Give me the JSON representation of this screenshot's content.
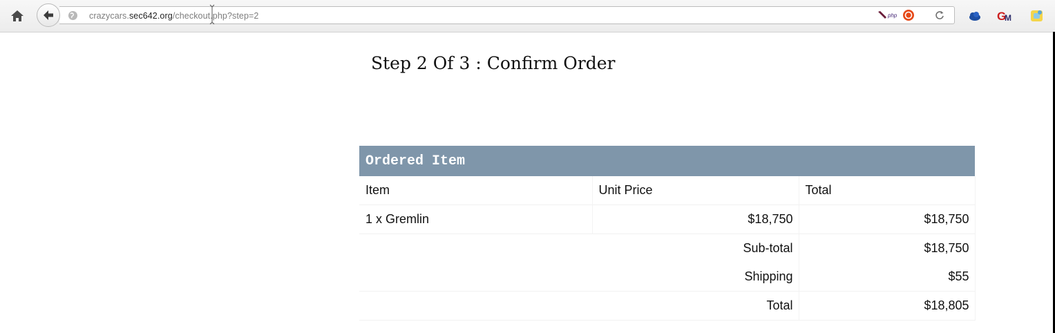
{
  "browser": {
    "url": {
      "prefix": "crazycars.",
      "domain": "sec642.org",
      "path": "/checkout.php?step=2"
    },
    "addon_labels": {
      "php": "php"
    }
  },
  "page": {
    "title": "Step 2 Of 3 : Confirm Order"
  },
  "order": {
    "section_heading": "Ordered Item",
    "columns": [
      "Item",
      "Unit Price",
      "Total"
    ],
    "items": [
      {
        "description": "1 x Gremlin",
        "unit_price": "$18,750",
        "total": "$18,750"
      }
    ],
    "subtotal_label": "Sub-total",
    "subtotal_value": "$18,750",
    "shipping_label": "Shipping",
    "shipping_value": "$55",
    "total_label": "Total",
    "total_value": "$18,805"
  },
  "colors": {
    "table_header_bg": "#7f96aa",
    "table_header_text": "#ffffff"
  }
}
